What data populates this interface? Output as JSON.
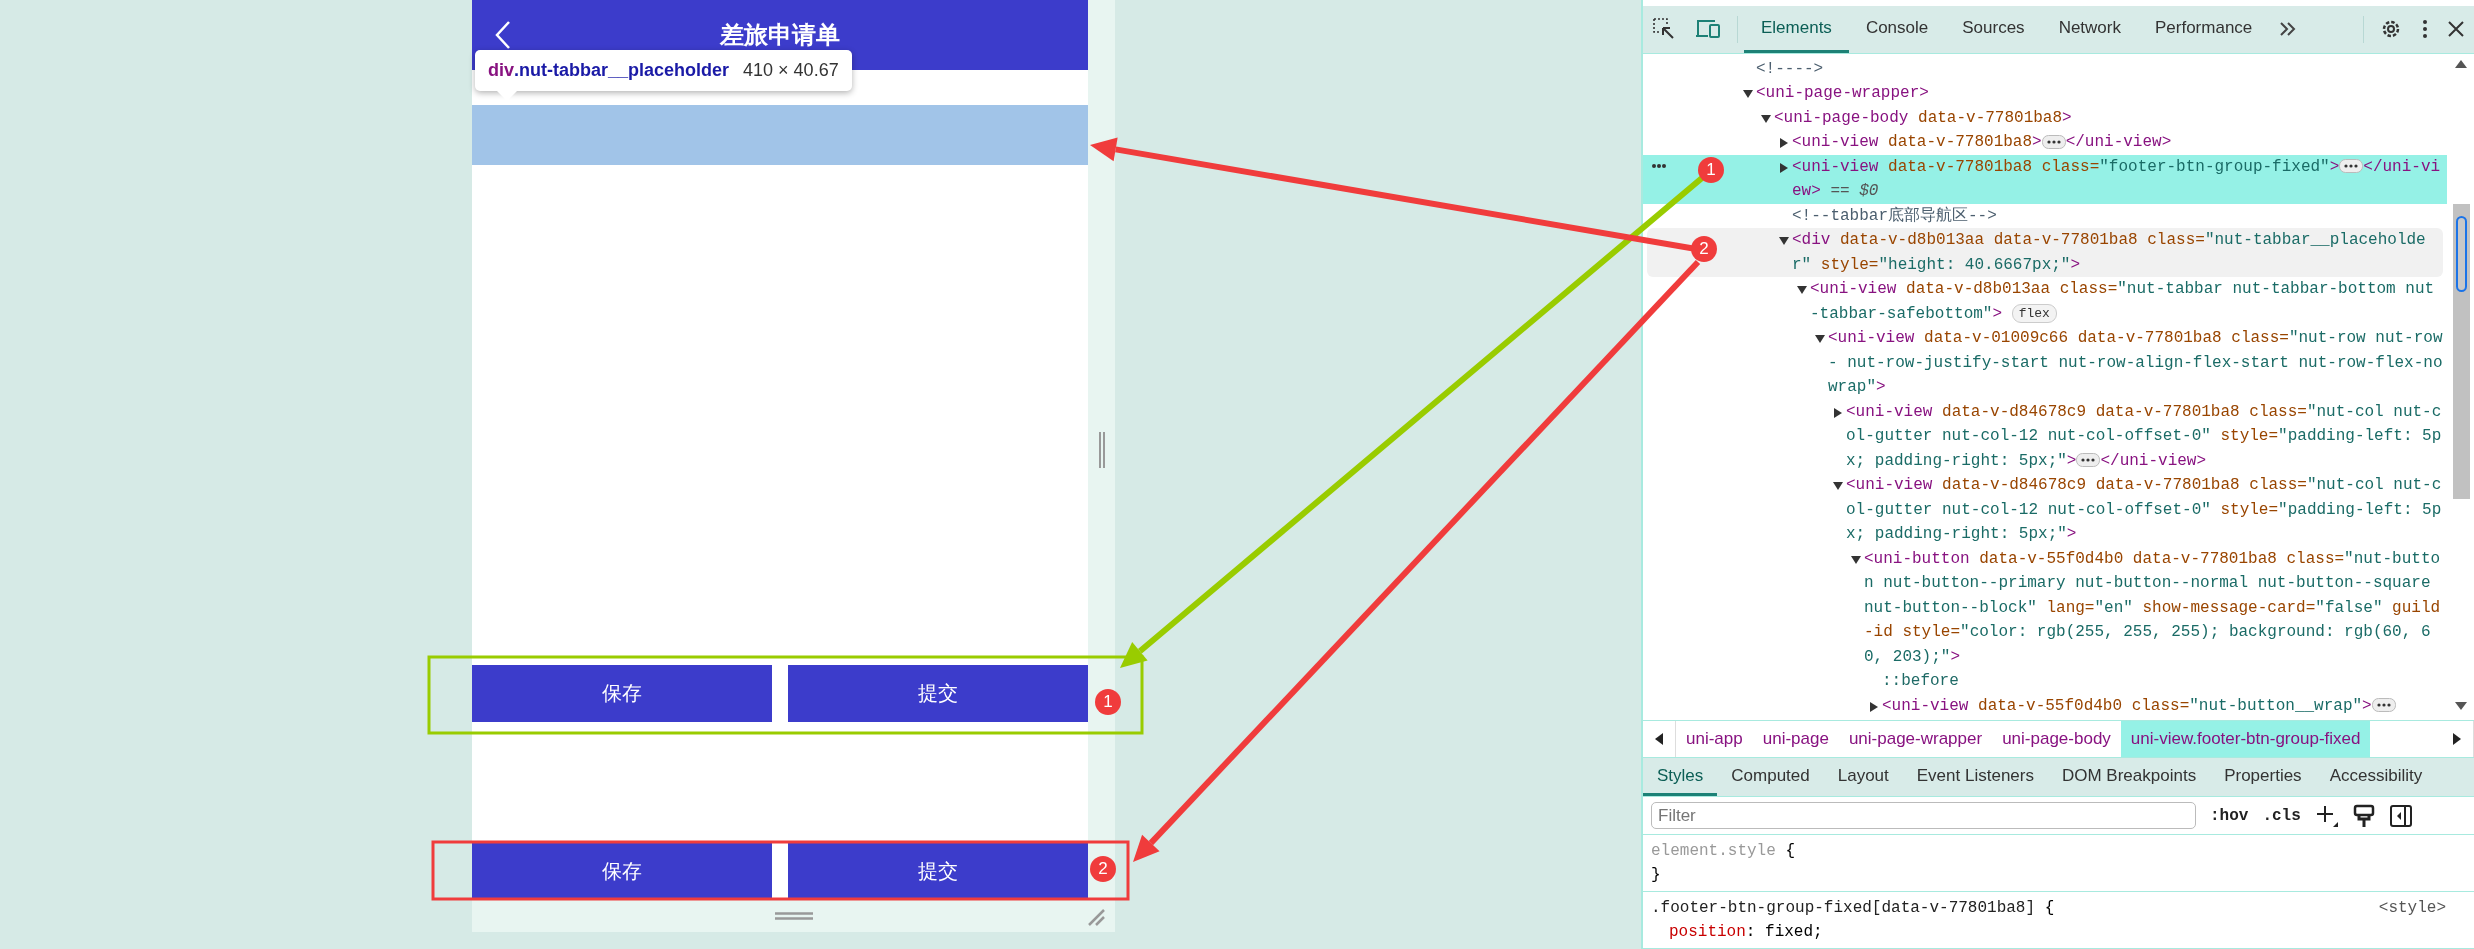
{
  "simulator": {
    "header": {
      "title": "差旅申请单"
    },
    "tooltip": {
      "tag": "div",
      "class_name": ".nut-tabbar__placeholder",
      "size": "410 × 40.67"
    },
    "button_groups": [
      {
        "buttons": [
          {
            "label": "保存"
          },
          {
            "label": "提交"
          }
        ]
      },
      {
        "buttons": [
          {
            "label": "保存"
          },
          {
            "label": "提交"
          }
        ]
      }
    ]
  },
  "callouts": [
    {
      "color": "#99cc00",
      "frame_badge": "1",
      "tree_badge": "1"
    },
    {
      "color": "#f03c3c",
      "frame_badge": "2",
      "tree_badge": "2"
    }
  ],
  "devtools": {
    "tabs": [
      {
        "label": "Elements",
        "selected": true
      },
      {
        "label": "Console",
        "selected": false
      },
      {
        "label": "Sources",
        "selected": false
      },
      {
        "label": "Network",
        "selected": false
      },
      {
        "label": "Performance",
        "selected": false
      }
    ],
    "tree": [
      {
        "kind": "comment",
        "text": "<!---->",
        "selected": false,
        "hovered": false
      },
      {
        "kind": "element",
        "text": "<uni-page-wrapper>",
        "expanded": true,
        "selected": false,
        "hovered": false,
        "children": [
          {
            "kind": "element",
            "text": "<uni-page-body data-v-77801ba8>",
            "expanded": true,
            "selected": false,
            "hovered": false,
            "children": [
              {
                "kind": "element",
                "text": "<uni-view data-v-77801ba8>",
                "expanded": false,
                "closing": "</uni-view>",
                "selected": false,
                "hovered": false
              },
              {
                "kind": "element",
                "text": "<uni-view data-v-77801ba8 class=\"footer-btn-group-fixed\">",
                "expanded": false,
                "closing": "</uni-view>",
                "note": "== $0",
                "selected": true,
                "hovered": false
              },
              {
                "kind": "comment",
                "text": "<!--tabbar底部导航区-->",
                "selected": false,
                "hovered": false
              },
              {
                "kind": "element",
                "text": "<div data-v-d8b013aa data-v-77801ba8 class=\"nut-tabbar__placeholder\" style=\"height: 40.6667px;\">",
                "expanded": true,
                "selected": false,
                "hovered": true,
                "children": [
                  {
                    "kind": "element",
                    "text": "<uni-view data-v-d8b013aa class=\"nut-tabbar nut-tabbar-bottom nut-tabbar-safebottom\">",
                    "expanded": true,
                    "badge": "flex",
                    "selected": false,
                    "hovered": false,
                    "children": [
                      {
                        "kind": "element",
                        "text": "<uni-view data-v-01009c66 data-v-77801ba8 class=\"nut-row nut-row- nut-row-justify-start nut-row-align-flex-start nut-row-flex-nowrap\">",
                        "expanded": true,
                        "selected": false,
                        "hovered": false,
                        "children": [
                          {
                            "kind": "element",
                            "text": "<uni-view data-v-d84678c9 data-v-77801ba8 class=\"nut-col nut-col-gutter nut-col-12 nut-col-offset-0\" style=\"padding-left: 5px; padding-right: 5px;\">",
                            "expanded": false,
                            "closing": "</uni-view>",
                            "selected": false,
                            "hovered": false
                          },
                          {
                            "kind": "element",
                            "text": "<uni-view data-v-d84678c9 data-v-77801ba8 class=\"nut-col nut-col-gutter nut-col-12 nut-col-offset-0\" style=\"padding-left: 5px; padding-right: 5px;\">",
                            "expanded": true,
                            "selected": false,
                            "hovered": false,
                            "children": [
                              {
                                "kind": "element",
                                "text": "<uni-button data-v-55f0d4b0 data-v-77801ba8 class=\"nut-button nut-button--primary nut-button--normal nut-button--square nut-button--block\" lang=\"en\" show-message-card=\"false\" guild-id style=\"color: rgb(255, 255, 255); background: rgb(60, 60, 203);\">",
                                "expanded": true,
                                "selected": false,
                                "hovered": false,
                                "children": [
                                  {
                                    "kind": "pseudo",
                                    "text": "::before",
                                    "selected": false,
                                    "hovered": false
                                  },
                                  {
                                    "kind": "element",
                                    "text": "<uni-view data-v-55f0d4b0 class=\"nut-button__wrap\">",
                                    "expanded": false,
                                    "selected": false,
                                    "hovered": false
                                  }
                                ]
                              }
                            ]
                          }
                        ]
                      }
                    ]
                  }
                ]
              }
            ]
          }
        ]
      }
    ],
    "breadcrumbs": [
      {
        "label": "uni-app",
        "selected": false
      },
      {
        "label": "uni-page",
        "selected": false
      },
      {
        "label": "uni-page-wrapper",
        "selected": false
      },
      {
        "label": "uni-page-body",
        "selected": false
      },
      {
        "label": "uni-view.footer-btn-group-fixed",
        "selected": true
      }
    ],
    "panel_tabs": [
      {
        "label": "Styles",
        "selected": true
      },
      {
        "label": "Computed",
        "selected": false
      },
      {
        "label": "Layout",
        "selected": false
      },
      {
        "label": "Event Listeners",
        "selected": false
      },
      {
        "label": "DOM Breakpoints",
        "selected": false
      },
      {
        "label": "Properties",
        "selected": false
      },
      {
        "label": "Accessibility",
        "selected": false
      }
    ],
    "filter": {
      "placeholder": "Filter"
    },
    "filter_buttons": [
      ":hov",
      ".cls"
    ],
    "rules": [
      {
        "selector": "element.style",
        "open": "{",
        "close": "}",
        "inactive": true
      },
      {
        "selector": ".footer-btn-group-fixed[data-v-77801ba8]",
        "open": "{",
        "source": "<style>",
        "inactive": false,
        "declarations": [
          {
            "property": "position",
            "colon": ":",
            "value": "fixed;"
          }
        ]
      }
    ]
  }
}
